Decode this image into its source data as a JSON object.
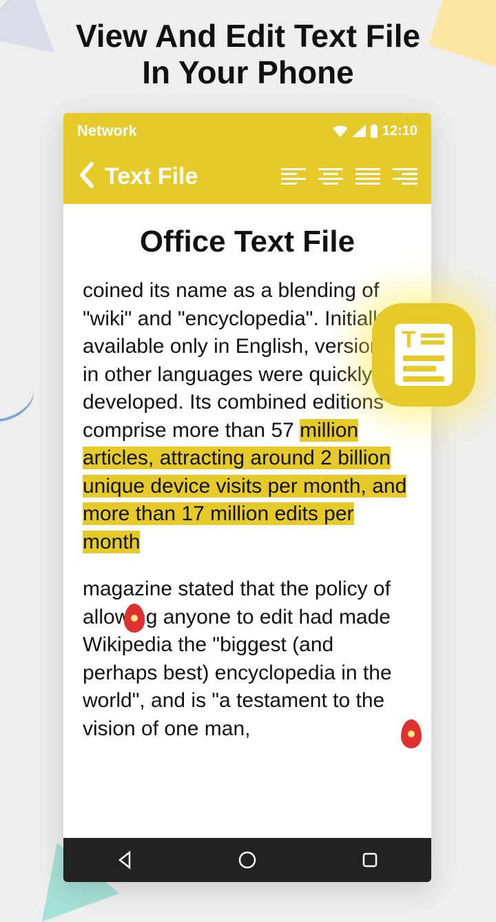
{
  "promo": {
    "headline_l1": "View And Edit Text File",
    "headline_l2": "In Your Phone"
  },
  "statusbar": {
    "network": "Network",
    "time": "12:10"
  },
  "appbar": {
    "title": "Text File"
  },
  "document": {
    "title": "Office Text File",
    "para1_pre": "coined its name as a blending of \"wiki\" and \"encyclopedia\". Initially available only in English, versions in other languages were quickly developed. Its combined editions comprise more than 57 ",
    "para1_hl": "million articles, attracting around 2 billion unique device visits per month, and more than 17 million edits per month",
    "para2": "magazine stated that the policy of allowing anyone to edit had made Wikipedia the \"biggest (and perhaps best) encyclopedia in the world\", and is \"a testament to the vision of one man,"
  },
  "colors": {
    "accent": "#e6ca2a"
  }
}
